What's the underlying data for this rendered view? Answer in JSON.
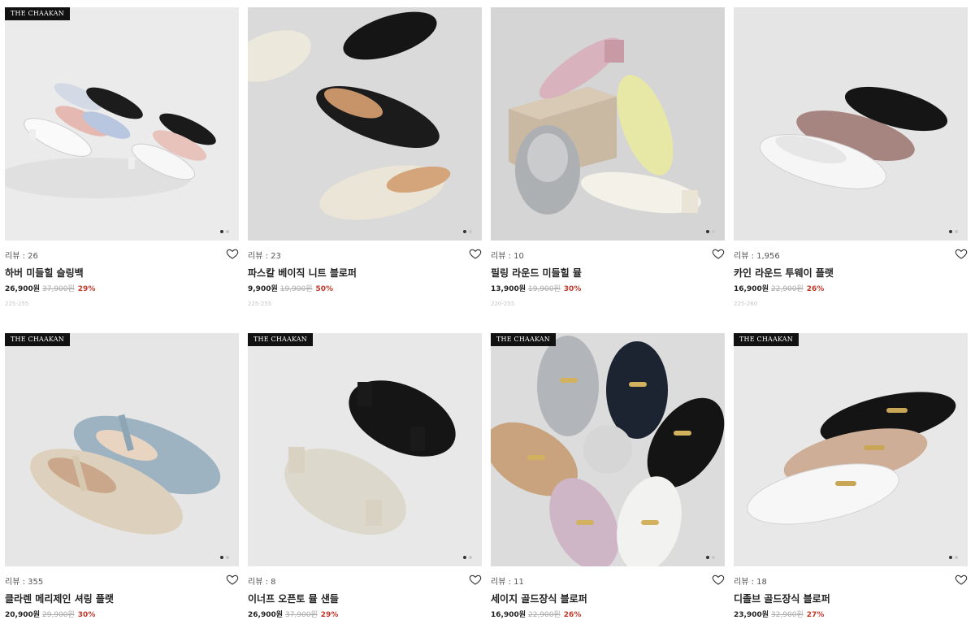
{
  "brand_tag": "THE CHAAKAN",
  "products": [
    {
      "review_label": "리뷰 : 26",
      "name": "하버 미들힐 슬링백",
      "price": "26,900원",
      "original_price": "37,900원",
      "discount": "29%",
      "size": "225-255",
      "has_brand_tag": true,
      "bg": "#e9e9e9"
    },
    {
      "review_label": "리뷰 : 23",
      "name": "파스칼 베이직 니트 블로퍼",
      "price": "9,900원",
      "original_price": "19,900원",
      "discount": "50%",
      "size": "225-255",
      "has_brand_tag": false,
      "bg": "#d9d9d9"
    },
    {
      "review_label": "리뷰 : 10",
      "name": "필링 라운드 미들힐 뮬",
      "price": "13,900원",
      "original_price": "19,900원",
      "discount": "30%",
      "size": "220-255",
      "has_brand_tag": false,
      "bg": "#d6d6d6"
    },
    {
      "review_label": "리뷰 : 1,956",
      "name": "카인 라운드 투웨이 플랫",
      "price": "16,900원",
      "original_price": "22,900원",
      "discount": "26%",
      "size": "225-260",
      "has_brand_tag": false,
      "bg": "#e4e4e4"
    },
    {
      "review_label": "리뷰 : 355",
      "name": "클라렌 메리제인 셔링 플랫",
      "price": "20,900원",
      "original_price": "29,900원",
      "discount": "30%",
      "size": "",
      "has_brand_tag": true,
      "bg": "#e6e6e6"
    },
    {
      "review_label": "리뷰 : 8",
      "name": "이너프 오픈토 뮬 샌들",
      "price": "26,900원",
      "original_price": "37,900원",
      "discount": "29%",
      "size": "",
      "has_brand_tag": true,
      "bg": "#e7e7e7"
    },
    {
      "review_label": "리뷰 : 11",
      "name": "세이지 골드장식 블로퍼",
      "price": "16,900원",
      "original_price": "22,900원",
      "discount": "26%",
      "size": "",
      "has_brand_tag": true,
      "bg": "#dcdcdc"
    },
    {
      "review_label": "리뷰 : 18",
      "name": "디졸브 골드장식 블로퍼",
      "price": "23,900원",
      "original_price": "32,900원",
      "discount": "27%",
      "size": "",
      "has_brand_tag": true,
      "bg": "#e8e8e8"
    }
  ],
  "icons": {
    "wishlist": "heart-outline-icon"
  }
}
